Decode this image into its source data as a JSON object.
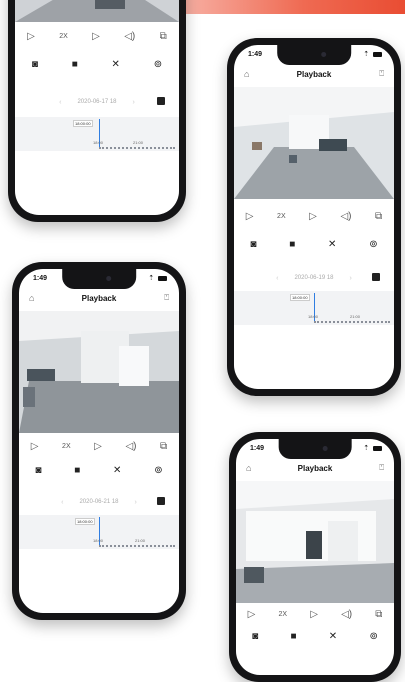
{
  "app": {
    "title": "Playback",
    "time": "1:49"
  },
  "phones": [
    {
      "id": "top-left",
      "date": "2020-06-17 18",
      "time_tag": "18:00:00",
      "tick_a": "18:00",
      "tick_b": "21:00"
    },
    {
      "id": "top-right",
      "date": "2020-06-19 18",
      "time_tag": "18:00:00",
      "tick_a": "18:00",
      "tick_b": "21:00"
    },
    {
      "id": "bottom-left",
      "date": "2020-06-21 18",
      "time_tag": "18:00:00",
      "tick_a": "18:00",
      "tick_b": "21:00"
    },
    {
      "id": "bottom-right"
    }
  ],
  "icons": {
    "controls": [
      "play-icon",
      "speed-icon",
      "next-icon",
      "volume-icon",
      "fullscreen-icon"
    ],
    "actions": [
      "camera-icon",
      "record-icon",
      "cut-icon",
      "settings-icon"
    ]
  },
  "colors": {
    "accent_gradient_end": "#e94d33",
    "timeline_marker": "#2f7de1",
    "phone_body": "#141416"
  }
}
